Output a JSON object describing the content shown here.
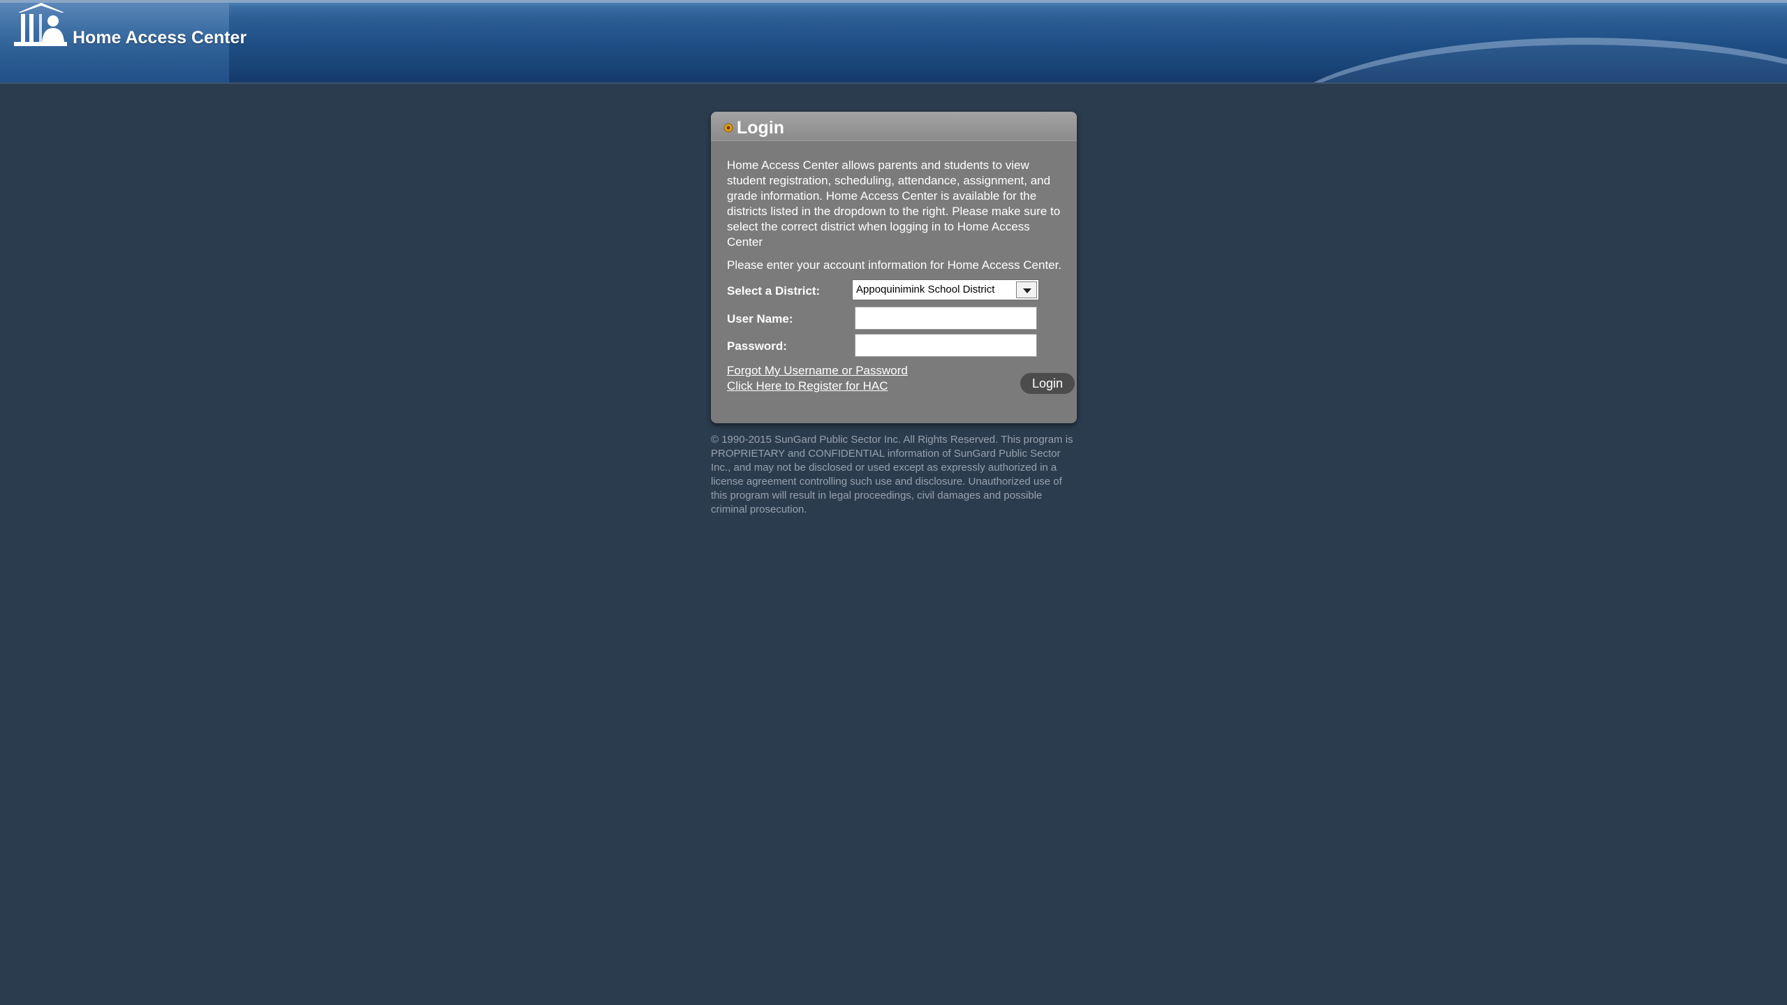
{
  "header": {
    "app_title": "Home Access Center",
    "logo_icon": "school-building-person-icon"
  },
  "login_panel": {
    "title": "Login",
    "title_icon": "orange-dot-icon",
    "intro": "Home Access Center allows parents and students to view student registration, scheduling, attendance, assignment, and grade information. Home Access Center is available for the districts listed in the dropdown to the right. Please make sure to select the correct district when logging in to Home Access Center",
    "prompt": "Please enter your account information for Home Access Center.",
    "district": {
      "label": "Select a District:",
      "selected": "Appoquinimink School District"
    },
    "username": {
      "label": "User Name:",
      "value": ""
    },
    "password": {
      "label": "Password:",
      "value": ""
    },
    "links": {
      "forgot": "Forgot My Username or Password",
      "register": "Click Here to Register for HAC"
    },
    "login_button": "Login"
  },
  "copyright": "© 1990-2015 SunGard Public Sector Inc. All Rights Reserved. This program is PROPRIETARY and CONFIDENTIAL information of SunGard Public Sector Inc., and may not be disclosed or used except as expressly authorized in a license agreement controlling such use and disclosure. Unauthorized use of this program will result in legal proceedings, civil damages and possible criminal prosecution.",
  "colors": {
    "background": "#2c3c4f",
    "header_blue": "#1f4f86",
    "panel_gray": "#7b7b7b",
    "button_dark": "#4c4c4c",
    "accent_orange": "#e0a020"
  }
}
